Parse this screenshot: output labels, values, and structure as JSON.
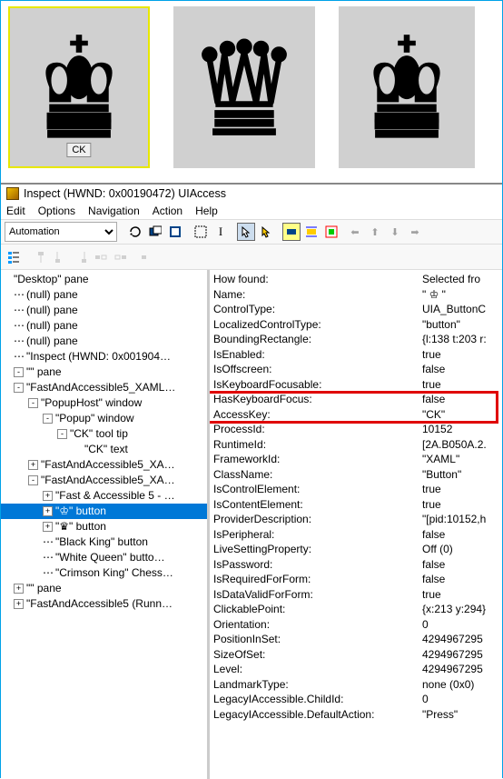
{
  "pieces": {
    "tooltip": "CK"
  },
  "inspect": {
    "title": "Inspect  (HWND: 0x00190472)  UIAccess",
    "menu": [
      "Edit",
      "Options",
      "Navigation",
      "Action",
      "Help"
    ],
    "combo": "Automation"
  },
  "tree": {
    "n0": "\"Desktop\" pane",
    "n1": "(null) pane",
    "n2": "(null) pane",
    "n3": "(null) pane",
    "n4": "(null) pane",
    "n5": "\"Inspect  (HWND: 0x001904…",
    "n6": "\"\" pane",
    "n7": "\"FastAndAccessible5_XAML…",
    "n8": "\"PopupHost\" window",
    "n9": "\"Popup\" window",
    "n10": "\"CK\" tool tip",
    "n11": "\"CK\" text",
    "n12": "\"FastAndAccessible5_XA…",
    "n13": "\"FastAndAccessible5_XA…",
    "n14": "\"Fast & Accessible 5 - …",
    "n15": "\"♔\" button",
    "n16": "\"♛\" button",
    "n17": "\"Black King\" button",
    "n18": "\"White Queen\" butto…",
    "n19": "\"Crimson King\" Chess…",
    "n20": "\"\" pane",
    "n21": "\"FastAndAccessible5 (Runn…"
  },
  "props": [
    {
      "k": "How found:",
      "v": "Selected fro"
    },
    {
      "k": "Name:",
      "v": "\" ♔ \""
    },
    {
      "k": "ControlType:",
      "v": "UIA_ButtonC"
    },
    {
      "k": "LocalizedControlType:",
      "v": "\"button\""
    },
    {
      "k": "BoundingRectangle:",
      "v": "{l:138 t:203 r:"
    },
    {
      "k": "IsEnabled:",
      "v": "true"
    },
    {
      "k": "IsOffscreen:",
      "v": "false"
    },
    {
      "k": "IsKeyboardFocusable:",
      "v": "true"
    },
    {
      "k": "HasKeyboardFocus:",
      "v": "false"
    },
    {
      "k": "AccessKey:",
      "v": "\"CK\""
    },
    {
      "k": "ProcessId:",
      "v": "10152"
    },
    {
      "k": "RuntimeId:",
      "v": "[2A.B050A.2."
    },
    {
      "k": "FrameworkId:",
      "v": "\"XAML\""
    },
    {
      "k": "ClassName:",
      "v": "\"Button\""
    },
    {
      "k": "IsControlElement:",
      "v": "true"
    },
    {
      "k": "IsContentElement:",
      "v": "true"
    },
    {
      "k": "ProviderDescription:",
      "v": "\"[pid:10152,h"
    },
    {
      "k": "IsPeripheral:",
      "v": "false"
    },
    {
      "k": "LiveSettingProperty:",
      "v": "Off (0)"
    },
    {
      "k": "IsPassword:",
      "v": "false"
    },
    {
      "k": "IsRequiredForForm:",
      "v": "false"
    },
    {
      "k": "IsDataValidForForm:",
      "v": "true"
    },
    {
      "k": "ClickablePoint:",
      "v": "{x:213 y:294}"
    },
    {
      "k": "Orientation:",
      "v": "0"
    },
    {
      "k": "PositionInSet:",
      "v": "4294967295"
    },
    {
      "k": "SizeOfSet:",
      "v": "4294967295"
    },
    {
      "k": "Level:",
      "v": "4294967295"
    },
    {
      "k": "LandmarkType:",
      "v": "none (0x0)"
    },
    {
      "k": "LegacyIAccessible.ChildId:",
      "v": "0"
    },
    {
      "k": "LegacyIAccessible.DefaultAction:",
      "v": "\"Press\""
    }
  ]
}
